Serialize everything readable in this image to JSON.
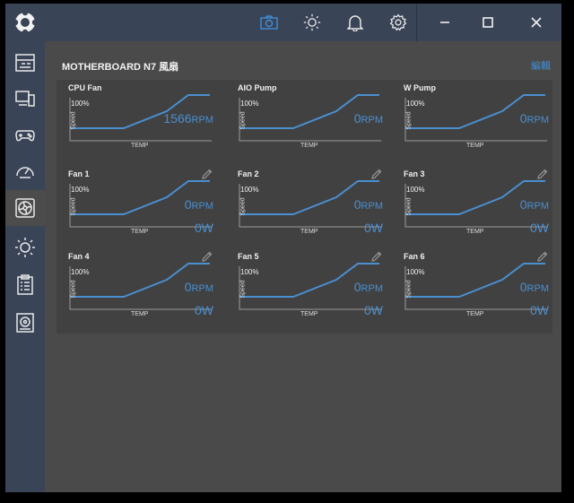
{
  "title": "MOTHERBOARD N7 風扇",
  "edit_label": "編輯",
  "colors": {
    "accent": "#3f8fd8",
    "sidebar": "#3a4457",
    "content": "#4a4a4a",
    "panel": "#414141"
  },
  "sidebar": {
    "items": [
      {
        "icon": "dashboard-icon"
      },
      {
        "icon": "monitor-icon"
      },
      {
        "icon": "gamepad-icon"
      },
      {
        "icon": "gauge-icon"
      },
      {
        "icon": "fan-icon",
        "active": true
      },
      {
        "icon": "brightness-icon"
      },
      {
        "icon": "clipboard-icon"
      },
      {
        "icon": "disk-icon"
      }
    ]
  },
  "topbar": {
    "icons": [
      "camera-icon",
      "brightness-icon",
      "bell-icon",
      "gear-icon"
    ],
    "window_controls": [
      "minimize-icon",
      "maximize-icon",
      "close-icon"
    ]
  },
  "axis": {
    "max_label": "100%",
    "y_label": "Speed",
    "x_label": "TEMP"
  },
  "fans": [
    {
      "name": "CPU Fan",
      "rpm": "1566",
      "rpm_unit": "RPM",
      "editable": false
    },
    {
      "name": "AIO Pump",
      "rpm": "0",
      "rpm_unit": "RPM",
      "editable": false
    },
    {
      "name": "W Pump",
      "rpm": "0",
      "rpm_unit": "RPM",
      "editable": false
    },
    {
      "name": "Fan 1",
      "rpm": "0",
      "rpm_unit": "RPM",
      "power": "0W",
      "editable": true
    },
    {
      "name": "Fan 2",
      "rpm": "0",
      "rpm_unit": "RPM",
      "power": "0W",
      "editable": true
    },
    {
      "name": "Fan 3",
      "rpm": "0",
      "rpm_unit": "RPM",
      "power": "0W",
      "editable": true
    },
    {
      "name": "Fan 4",
      "rpm": "0",
      "rpm_unit": "RPM",
      "power": "0W",
      "editable": true
    },
    {
      "name": "Fan 5",
      "rpm": "0",
      "rpm_unit": "RPM",
      "power": "0W",
      "editable": true
    },
    {
      "name": "Fan 6",
      "rpm": "0",
      "rpm_unit": "RPM",
      "power": "0W",
      "editable": true
    }
  ]
}
